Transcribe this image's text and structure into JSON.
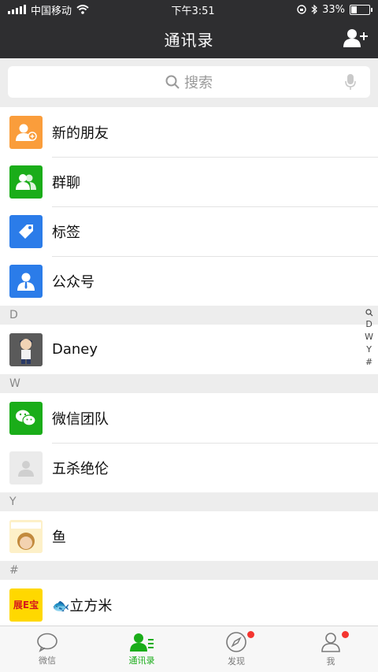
{
  "status": {
    "carrier": "中国移动",
    "time": "下午3:51",
    "battery_pct": "33%",
    "battery_level": 0.33
  },
  "nav": {
    "title": "通讯录"
  },
  "search": {
    "placeholder": "搜索"
  },
  "functions": [
    {
      "label": "新的朋友",
      "color": "#fa9d3b",
      "icon": "add-friend-icon"
    },
    {
      "label": "群聊",
      "color": "#1aad19",
      "icon": "group-chat-icon"
    },
    {
      "label": "标签",
      "color": "#2b7ce9",
      "icon": "tag-icon"
    },
    {
      "label": "公众号",
      "color": "#2b7ce9",
      "icon": "official-account-icon"
    }
  ],
  "sections": [
    {
      "letter": "D",
      "contacts": [
        {
          "name": "Daney",
          "avatar": "photo-avatar"
        }
      ]
    },
    {
      "letter": "W",
      "contacts": [
        {
          "name": "微信团队",
          "avatar": "wechat-team-avatar"
        },
        {
          "name": "五杀绝伦",
          "avatar": "default-avatar"
        }
      ]
    },
    {
      "letter": "Y",
      "contacts": [
        {
          "name": "鱼",
          "avatar": "photo-avatar"
        }
      ]
    },
    {
      "letter": "#",
      "contacts": [
        {
          "name": "🐟立方米",
          "avatar": "photo-avatar",
          "avatar_text": "展E宝"
        }
      ]
    }
  ],
  "index": [
    "D",
    "W",
    "Y",
    "#"
  ],
  "tabs": [
    {
      "label": "微信",
      "icon": "chat-bubble-icon",
      "active": false
    },
    {
      "label": "通讯录",
      "icon": "contacts-icon",
      "active": true
    },
    {
      "label": "发现",
      "icon": "compass-icon",
      "active": false,
      "badge": true
    },
    {
      "label": "我",
      "icon": "me-icon",
      "active": false,
      "badge": true
    }
  ],
  "colors": {
    "brand_green": "#1aad19",
    "nav_dark": "#2e2e30",
    "badge_red": "#f43530"
  }
}
